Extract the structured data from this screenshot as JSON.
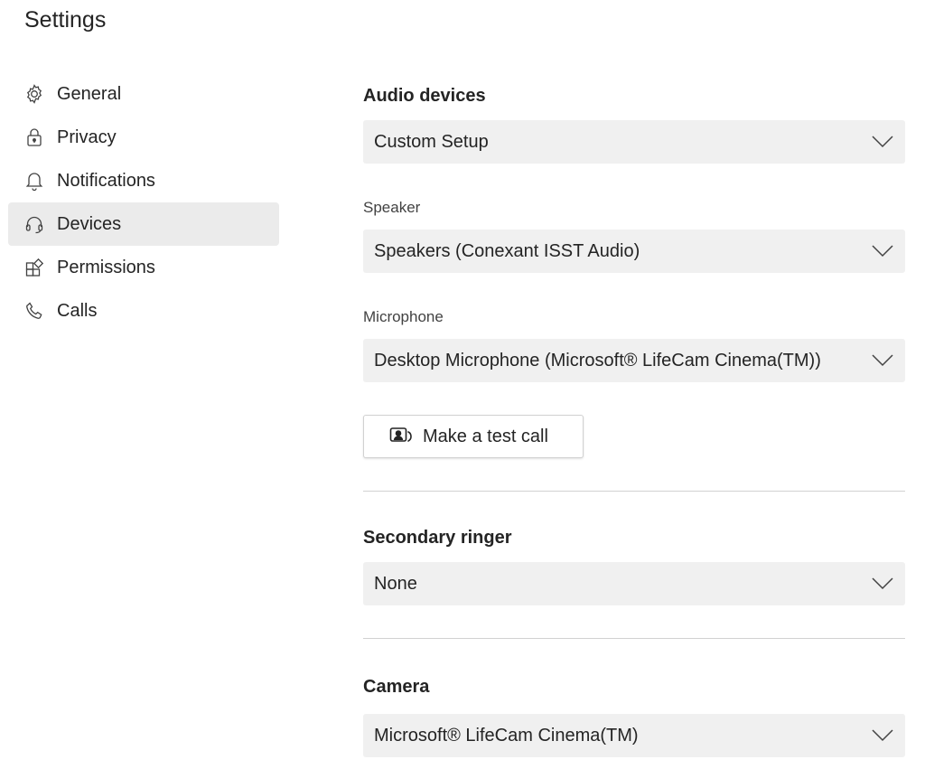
{
  "header": {
    "title": "Settings"
  },
  "sidebar": {
    "items": [
      {
        "label": "General",
        "icon": "gear-icon",
        "active": false
      },
      {
        "label": "Privacy",
        "icon": "lock-icon",
        "active": false
      },
      {
        "label": "Notifications",
        "icon": "bell-icon",
        "active": false
      },
      {
        "label": "Devices",
        "icon": "headset-icon",
        "active": true
      },
      {
        "label": "Permissions",
        "icon": "apps-icon",
        "active": false
      },
      {
        "label": "Calls",
        "icon": "phone-icon",
        "active": false
      }
    ]
  },
  "main": {
    "audio_devices": {
      "heading": "Audio devices",
      "selected": "Custom Setup"
    },
    "speaker": {
      "label": "Speaker",
      "selected": "Speakers (Conexant ISST Audio)"
    },
    "microphone": {
      "label": "Microphone",
      "selected": "Desktop Microphone (Microsoft® LifeCam Cinema(TM))"
    },
    "test_call": {
      "label": "Make a test call",
      "icon": "test-call-icon"
    },
    "secondary_ringer": {
      "heading": "Secondary ringer",
      "selected": "None"
    },
    "camera": {
      "heading": "Camera",
      "selected": "Microsoft® LifeCam Cinema(TM)"
    }
  },
  "colors": {
    "active_nav_bg": "#ebebeb",
    "dropdown_bg": "#f0f0f0",
    "divider": "#d1d1d1",
    "text": "#242424"
  }
}
